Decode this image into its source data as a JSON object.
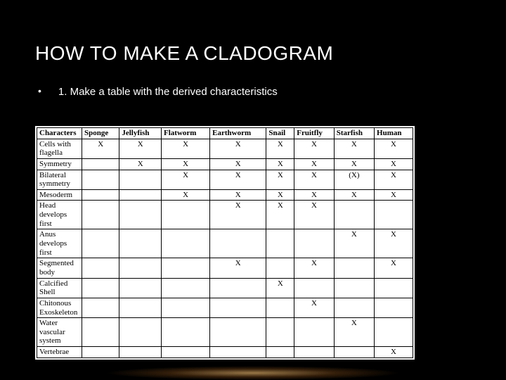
{
  "title": "HOW TO MAKE A CLADOGRAM",
  "bullet": "•",
  "bullet_text": "1. Make a table with the derived characteristics",
  "chart_data": {
    "type": "table",
    "header_label": "Characters",
    "columns": [
      "Sponge",
      "Jellyfish",
      "Flatworm",
      "Earthworm",
      "Snail",
      "Fruitfly",
      "Starfish",
      "Human"
    ],
    "rows": [
      {
        "label": "Cells with flagella",
        "marks": [
          "X",
          "X",
          "X",
          "X",
          "X",
          "X",
          "X",
          "X"
        ]
      },
      {
        "label": "Symmetry",
        "marks": [
          "",
          "X",
          "X",
          "X",
          "X",
          "X",
          "X",
          "X"
        ]
      },
      {
        "label": "Bilateral symmetry",
        "marks": [
          "",
          "",
          "X",
          "X",
          "X",
          "X",
          "(X)",
          "X"
        ]
      },
      {
        "label": "Mesoderm",
        "marks": [
          "",
          "",
          "X",
          "X",
          "X",
          "X",
          "X",
          "X"
        ]
      },
      {
        "label": "Head develops first",
        "marks": [
          "",
          "",
          "",
          "X",
          "X",
          "X",
          "",
          ""
        ]
      },
      {
        "label": "Anus develops first",
        "marks": [
          "",
          "",
          "",
          "",
          "",
          "",
          "X",
          "X"
        ]
      },
      {
        "label": "Segmented body",
        "marks": [
          "",
          "",
          "",
          "X",
          "",
          "X",
          "",
          "X"
        ]
      },
      {
        "label": "Calcified Shell",
        "marks": [
          "",
          "",
          "",
          "",
          "X",
          "",
          "",
          ""
        ]
      },
      {
        "label": "Chitonous Exoskeleton",
        "marks": [
          "",
          "",
          "",
          "",
          "",
          "X",
          "",
          ""
        ]
      },
      {
        "label": "Water vascular system",
        "marks": [
          "",
          "",
          "",
          "",
          "",
          "",
          "X",
          ""
        ]
      },
      {
        "label": "Vertebrae",
        "marks": [
          "",
          "",
          "",
          "",
          "",
          "",
          "",
          "X"
        ]
      }
    ]
  }
}
